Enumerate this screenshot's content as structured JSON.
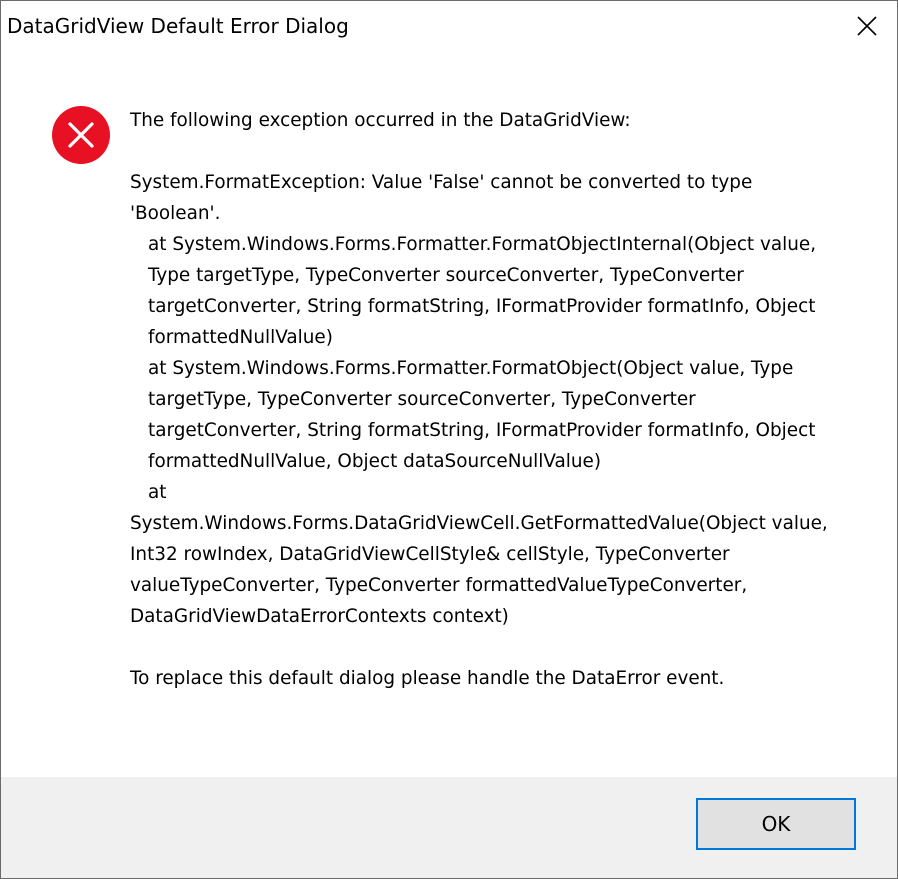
{
  "window": {
    "title": "DataGridView Default Error Dialog",
    "close_icon": "close-icon"
  },
  "dialog": {
    "icon": "error-icon",
    "icon_color": "#e81123",
    "intro": "The following exception occurred in the DataGridView:",
    "exception_line": "System.FormatException: Value 'False' cannot be converted to type 'Boolean'.",
    "stack_1": "at System.Windows.Forms.Formatter.FormatObjectInternal(Object value, Type targetType, TypeConverter sourceConverter, TypeConverter targetConverter, String formatString, IFormatProvider formatInfo, Object formattedNullValue)",
    "stack_2": "at System.Windows.Forms.Formatter.FormatObject(Object value, Type targetType, TypeConverter sourceConverter, TypeConverter targetConverter, String formatString, IFormatProvider formatInfo, Object formattedNullValue, Object dataSourceNullValue)",
    "stack_3_prefix": "at",
    "stack_3": "System.Windows.Forms.DataGridViewCell.GetFormattedValue(Object value, Int32 rowIndex, DataGridViewCellStyle& cellStyle, TypeConverter valueTypeConverter, TypeConverter formattedValueTypeConverter, DataGridViewDataErrorContexts context)",
    "footer_text": "To replace this default dialog please handle the DataError event."
  },
  "buttons": {
    "ok_label": "OK",
    "accent": "#0078d7"
  }
}
